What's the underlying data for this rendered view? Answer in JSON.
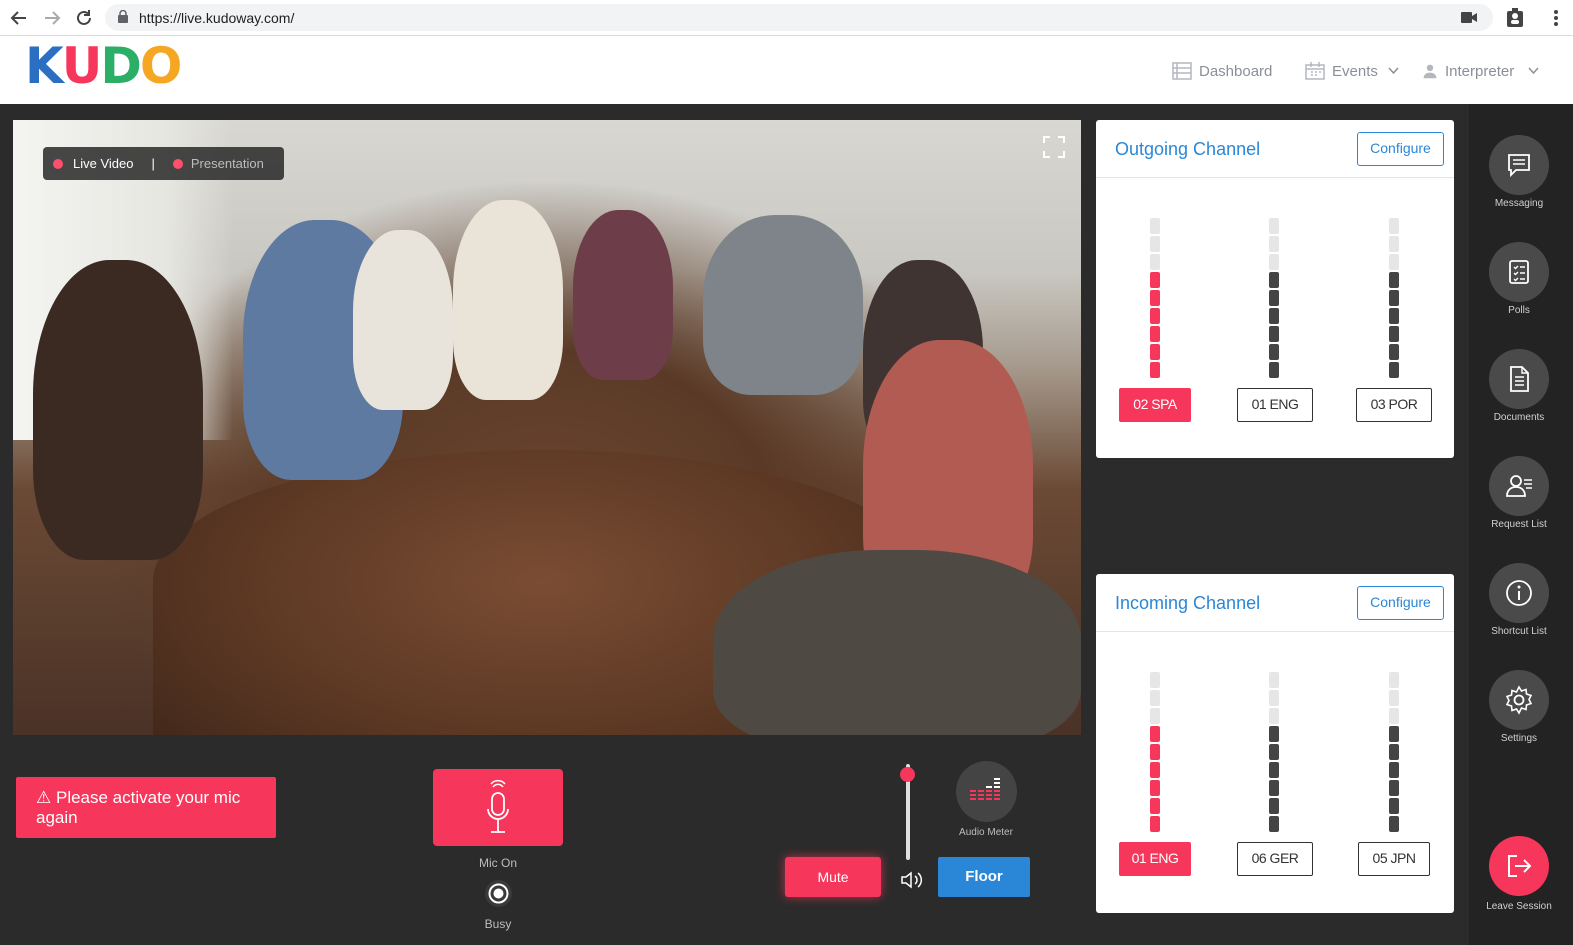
{
  "browser": {
    "url": "https://live.kudoway.com/"
  },
  "header": {
    "logo": [
      "K",
      "U",
      "D",
      "O"
    ],
    "nav": {
      "dashboard": "Dashboard",
      "events": "Events",
      "interpreter": "Interpreter"
    }
  },
  "video": {
    "tab_live": "Live Video",
    "tab_separator": "|",
    "tab_presentation": "Presentation"
  },
  "controls": {
    "warning": "Please activate your mic again",
    "warning_icon": "⚠",
    "mic_label": "Mic On",
    "busy_label": "Busy",
    "mute_label": "Mute",
    "floor_label": "Floor",
    "audio_meter_label": "Audio Meter"
  },
  "outgoing": {
    "title": "Outgoing Channel",
    "configure": "Configure",
    "channels": [
      {
        "label": "02 SPA",
        "active": true,
        "level": 6
      },
      {
        "label": "01 ENG",
        "active": false,
        "level": 6
      },
      {
        "label": "03 POR",
        "active": false,
        "level": 6
      }
    ]
  },
  "incoming": {
    "title": "Incoming Channel",
    "configure": "Configure",
    "channels": [
      {
        "label": "01 ENG",
        "active": true,
        "level": 6
      },
      {
        "label": "06 GER",
        "active": false,
        "level": 6
      },
      {
        "label": "05 JPN",
        "active": false,
        "level": 6
      }
    ]
  },
  "sidebar": {
    "items": [
      {
        "label": "Messaging",
        "icon": "message-icon"
      },
      {
        "label": "Polls",
        "icon": "polls-icon"
      },
      {
        "label": "Documents",
        "icon": "document-icon"
      },
      {
        "label": "Request List",
        "icon": "request-list-icon"
      },
      {
        "label": "Shortcut List",
        "icon": "info-icon"
      },
      {
        "label": "Settings",
        "icon": "gear-icon"
      }
    ],
    "leave": "Leave Session"
  },
  "colors": {
    "accent_red": "#f6365a",
    "accent_blue": "#2a87d8",
    "logo": [
      "#2a6fc1",
      "#f6365a",
      "#2bae66",
      "#f5a623"
    ]
  }
}
